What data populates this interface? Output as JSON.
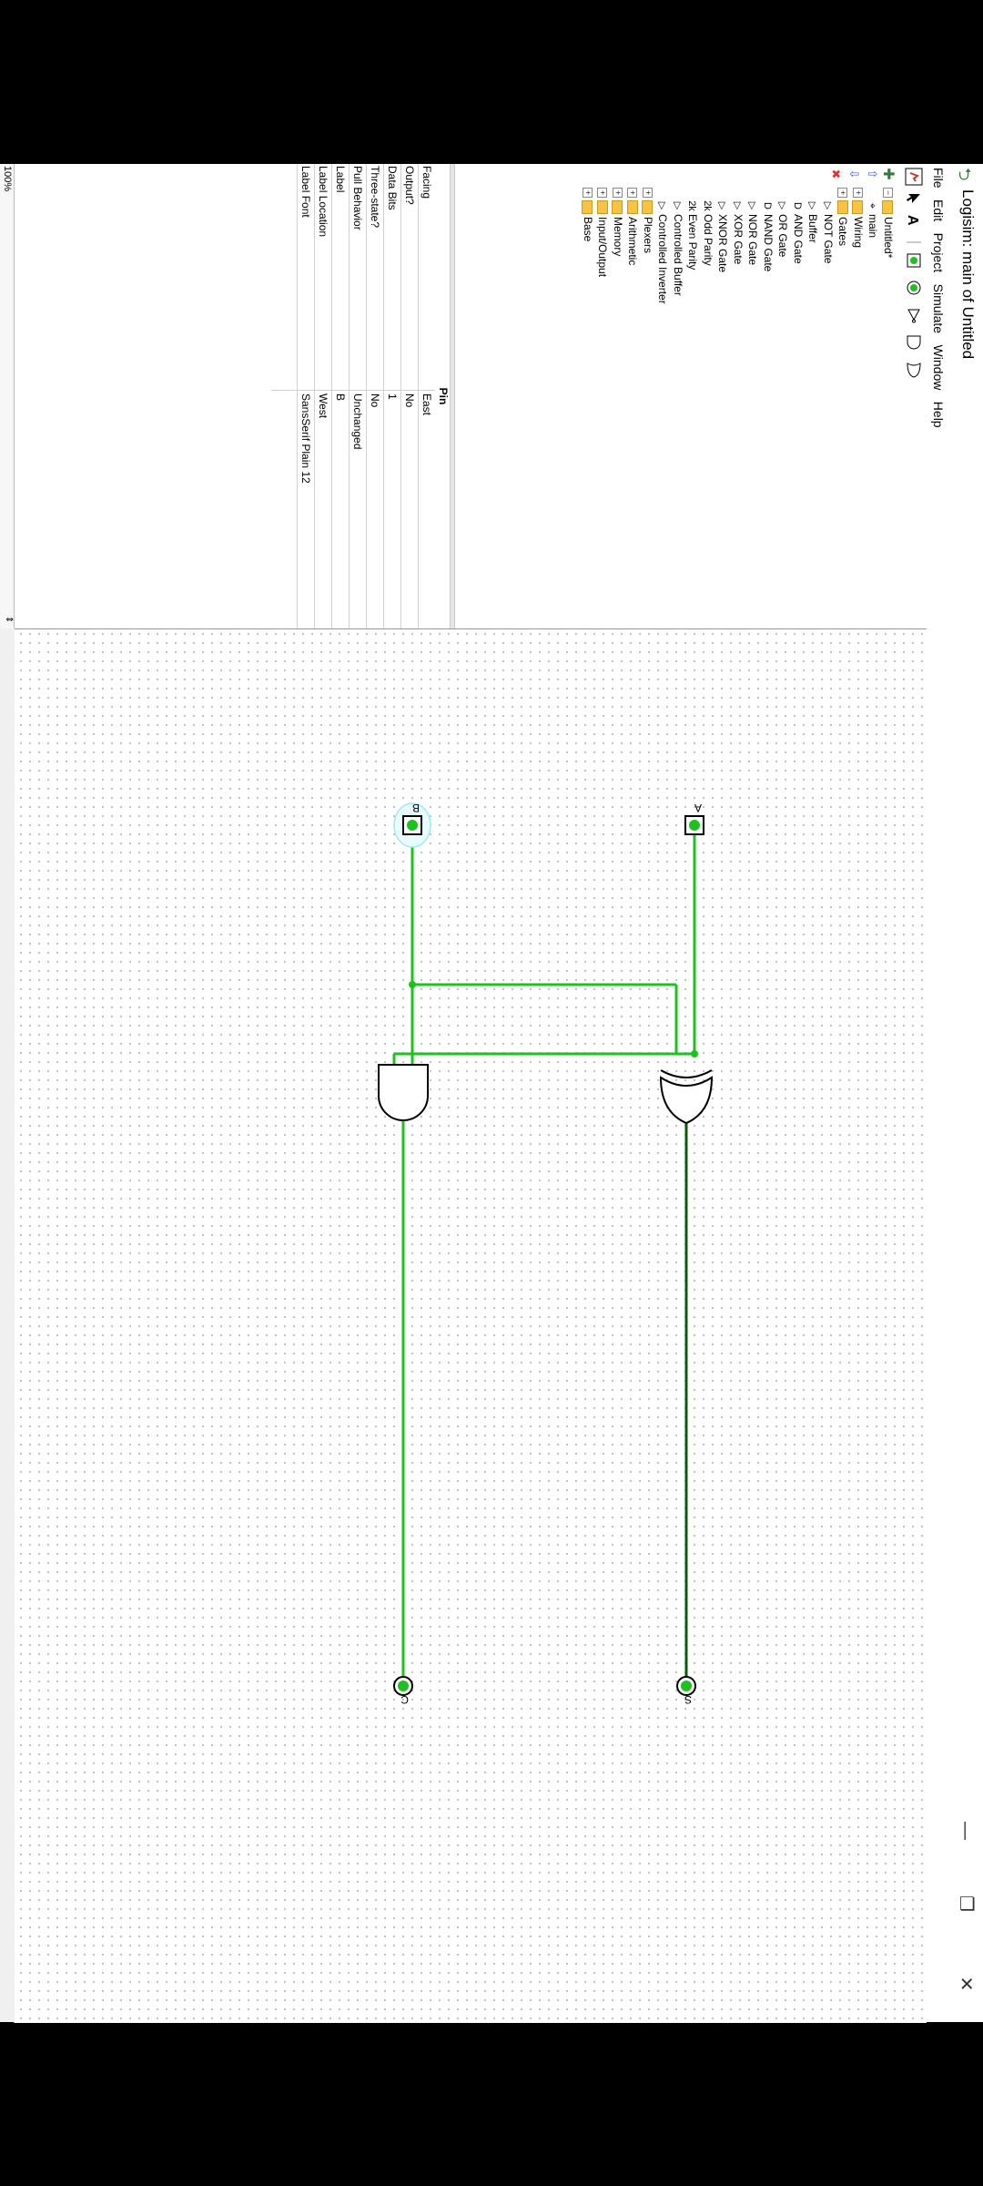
{
  "window": {
    "title": "Logisim: main of Untitled",
    "minimize_glyph": "—",
    "restore_glyph": "❐",
    "close_glyph": "✕"
  },
  "menu": [
    "File",
    "Edit",
    "Project",
    "Simulate",
    "Window",
    "Help"
  ],
  "toolbar_icons": [
    "poke-tool-icon",
    "select-tool-icon",
    "text-tool-icon",
    "input-pin-icon",
    "output-pin-icon",
    "not-gate-icon",
    "and-gate-icon",
    "or-gate-icon"
  ],
  "project_tree": [
    {
      "label": "Untitled*",
      "kind": "folder",
      "indent": 0
    },
    {
      "label": "main",
      "kind": "circuit",
      "indent": 1
    },
    {
      "label": "Wiring",
      "kind": "folder",
      "indent": 0
    },
    {
      "label": "Gates",
      "kind": "folder",
      "indent": 0
    },
    {
      "label": "NOT Gate",
      "kind": "gate",
      "glyph": "▷",
      "indent": 1
    },
    {
      "label": "Buffer",
      "kind": "gate",
      "glyph": "▷",
      "indent": 1
    },
    {
      "label": "AND Gate",
      "kind": "gate",
      "glyph": "D",
      "indent": 1
    },
    {
      "label": "OR Gate",
      "kind": "gate",
      "glyph": "▷",
      "indent": 1
    },
    {
      "label": "NAND Gate",
      "kind": "gate",
      "glyph": "D",
      "indent": 1
    },
    {
      "label": "NOR Gate",
      "kind": "gate",
      "glyph": "▷",
      "indent": 1
    },
    {
      "label": "XOR Gate",
      "kind": "gate",
      "glyph": "▷",
      "indent": 1
    },
    {
      "label": "XNOR Gate",
      "kind": "gate",
      "glyph": "▷",
      "indent": 1
    },
    {
      "label": "Odd Parity",
      "kind": "gate",
      "glyph": "2k",
      "indent": 1
    },
    {
      "label": "Even Parity",
      "kind": "gate",
      "glyph": "2k",
      "indent": 1
    },
    {
      "label": "Controlled Buffer",
      "kind": "gate",
      "glyph": "▷",
      "indent": 1
    },
    {
      "label": "Controlled Inverter",
      "kind": "gate",
      "glyph": "▷",
      "indent": 1
    },
    {
      "label": "Plexers",
      "kind": "folder",
      "indent": 0
    },
    {
      "label": "Arithmetic",
      "kind": "folder",
      "indent": 0
    },
    {
      "label": "Memory",
      "kind": "folder",
      "indent": 0
    },
    {
      "label": "Input/Output",
      "kind": "folder",
      "indent": 0
    },
    {
      "label": "Base",
      "kind": "folder",
      "indent": 0
    }
  ],
  "attributes": {
    "title": "Pin",
    "rows": [
      {
        "key": "Facing",
        "value": "East"
      },
      {
        "key": "Output?",
        "value": "No"
      },
      {
        "key": "Data Bits",
        "value": "1"
      },
      {
        "key": "Three-state?",
        "value": "No"
      },
      {
        "key": "Pull Behavior",
        "value": "Unchanged"
      },
      {
        "key": "Label",
        "value": "B"
      },
      {
        "key": "Label Location",
        "value": "West"
      },
      {
        "key": "Label Font",
        "value": "SansSerif Plain 12"
      }
    ]
  },
  "zoom": "100%",
  "circuit": {
    "inputs": [
      {
        "label": "A",
        "value": 1
      },
      {
        "label": "B",
        "value": 1,
        "selected": true
      }
    ],
    "gates": [
      "XOR",
      "AND"
    ],
    "outputs": [
      {
        "label": "S",
        "value": 0
      },
      {
        "label": "C",
        "value": 1
      }
    ],
    "wire_color_high": "#1ec21e",
    "wire_color_low": "#0a5c0a"
  }
}
